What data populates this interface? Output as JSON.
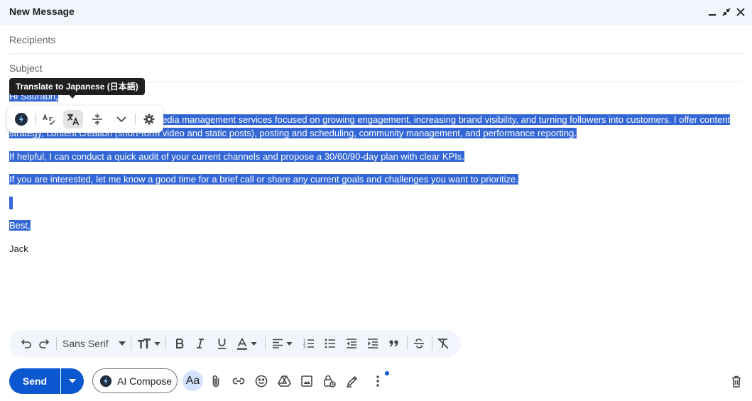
{
  "window": {
    "title": "New Message"
  },
  "fields": {
    "recipients_placeholder": "Recipients",
    "subject_placeholder": "Subject"
  },
  "tooltip": {
    "text": "Translate to Japanese (日本語)"
  },
  "body": {
    "greeting": "Hi Saurabh,",
    "para1_line1": "edia management services focused on growing engagement, increasing brand visibility, and turning followers into customers. I offer content",
    "para1_line2": "strategy, content creation (short-form video and static posts), posting and scheduling, community management, and performance reporting.",
    "para2": "If helpful, I can conduct a quick audit of your current channels and propose a 30/60/90-day plan with clear KPIs.",
    "para3": "If you are interested, let me know a good time for a brief call or share any current goals and challenges you want to prioritize.",
    "closing": "Best,",
    "signature": "Jack"
  },
  "format_toolbar": {
    "font_family": "Sans Serif"
  },
  "bottom_bar": {
    "send_label": "Send",
    "ai_compose_label": "AI Compose",
    "text_format_label": "Aa"
  },
  "colors": {
    "accent": "#0b57d0",
    "selection": "#3367d6",
    "header_bg": "#f2f6fc"
  }
}
